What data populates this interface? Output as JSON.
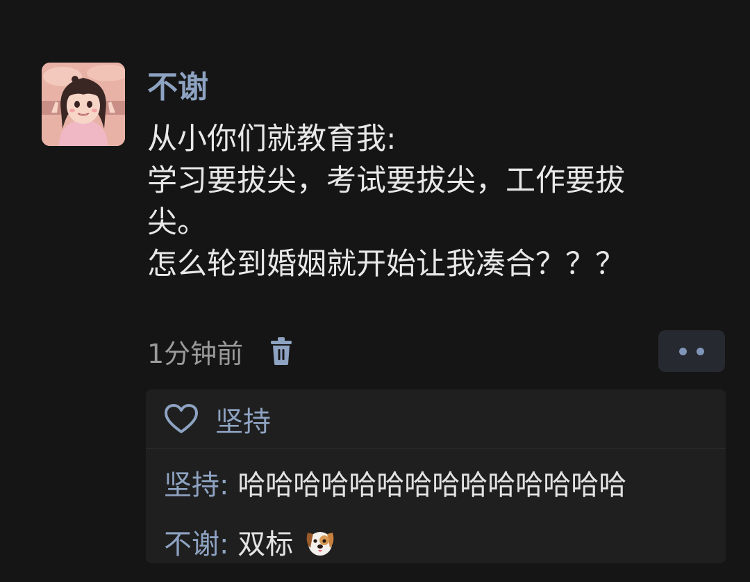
{
  "comment": {
    "author": "不谢",
    "lines": [
      "从小你们就教育我:",
      "学习要拔尖，考试要拔尖，工作要拔",
      "尖。",
      "怎么轮到婚姻就开始让我凑合？？？"
    ],
    "time": "1分钟前"
  },
  "likes": {
    "name": "坚持"
  },
  "replies": [
    {
      "author": "坚持",
      "separator": ": ",
      "text": "哈哈哈哈哈哈哈哈哈哈哈哈哈哈"
    },
    {
      "author": "不谢",
      "separator": ": ",
      "text": "双标",
      "emoji": "dog-face-emoji"
    }
  ],
  "icons": {
    "delete": "trash-icon",
    "more": "more-dots-icon",
    "like": "heart-outline-icon"
  },
  "colors": {
    "background": "#151515",
    "accent": "#8ea3c2",
    "panel": "#1f1f1f"
  }
}
